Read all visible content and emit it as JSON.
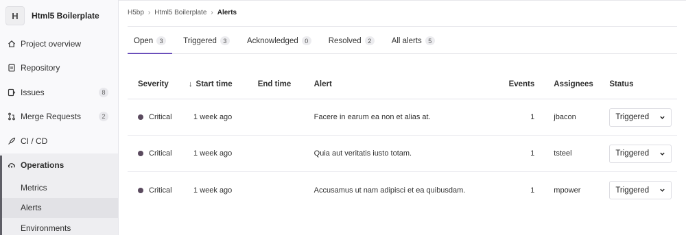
{
  "project": {
    "avatar_letter": "H",
    "name": "Html5 Boilerplate"
  },
  "sidebar": {
    "items": [
      {
        "label": "Project overview",
        "icon": "home-icon"
      },
      {
        "label": "Repository",
        "icon": "document-icon"
      },
      {
        "label": "Issues",
        "icon": "issues-icon",
        "count": "8"
      },
      {
        "label": "Merge Requests",
        "icon": "merge-request-icon",
        "count": "2"
      },
      {
        "label": "CI / CD",
        "icon": "rocket-icon"
      },
      {
        "label": "Operations",
        "icon": "cloud-gear-icon"
      }
    ],
    "sub_items": [
      {
        "label": "Metrics"
      },
      {
        "label": "Alerts"
      },
      {
        "label": "Environments"
      }
    ]
  },
  "breadcrumb": {
    "root": "H5bp",
    "project": "Html5 Boilerplate",
    "current": "Alerts"
  },
  "tabs": [
    {
      "label": "Open",
      "count": "3"
    },
    {
      "label": "Triggered",
      "count": "3"
    },
    {
      "label": "Acknowledged",
      "count": "0"
    },
    {
      "label": "Resolved",
      "count": "2"
    },
    {
      "label": "All alerts",
      "count": "5"
    }
  ],
  "table": {
    "headers": {
      "severity": "Severity",
      "start_time": "Start time",
      "end_time": "End time",
      "alert": "Alert",
      "events": "Events",
      "assignees": "Assignees",
      "status": "Status"
    },
    "sort_arrow": "↓",
    "rows": [
      {
        "severity": "Critical",
        "start_time": "1 week ago",
        "end_time": "",
        "alert": "Facere in earum ea non et alias at.",
        "events": "1",
        "assignee": "jbacon",
        "status": "Triggered"
      },
      {
        "severity": "Critical",
        "start_time": "1 week ago",
        "end_time": "",
        "alert": "Quia aut veritatis iusto totam.",
        "events": "1",
        "assignee": "tsteel",
        "status": "Triggered"
      },
      {
        "severity": "Critical",
        "start_time": "1 week ago",
        "end_time": "",
        "alert": "Accusamus ut nam adipisci et ea quibusdam.",
        "events": "1",
        "assignee": "mpower",
        "status": "Triggered"
      }
    ]
  },
  "colors": {
    "active_tab_underline": "#6b4fbb",
    "severity_critical": "#5a4a5e",
    "sidebar_bg": "#f9f9fb"
  }
}
